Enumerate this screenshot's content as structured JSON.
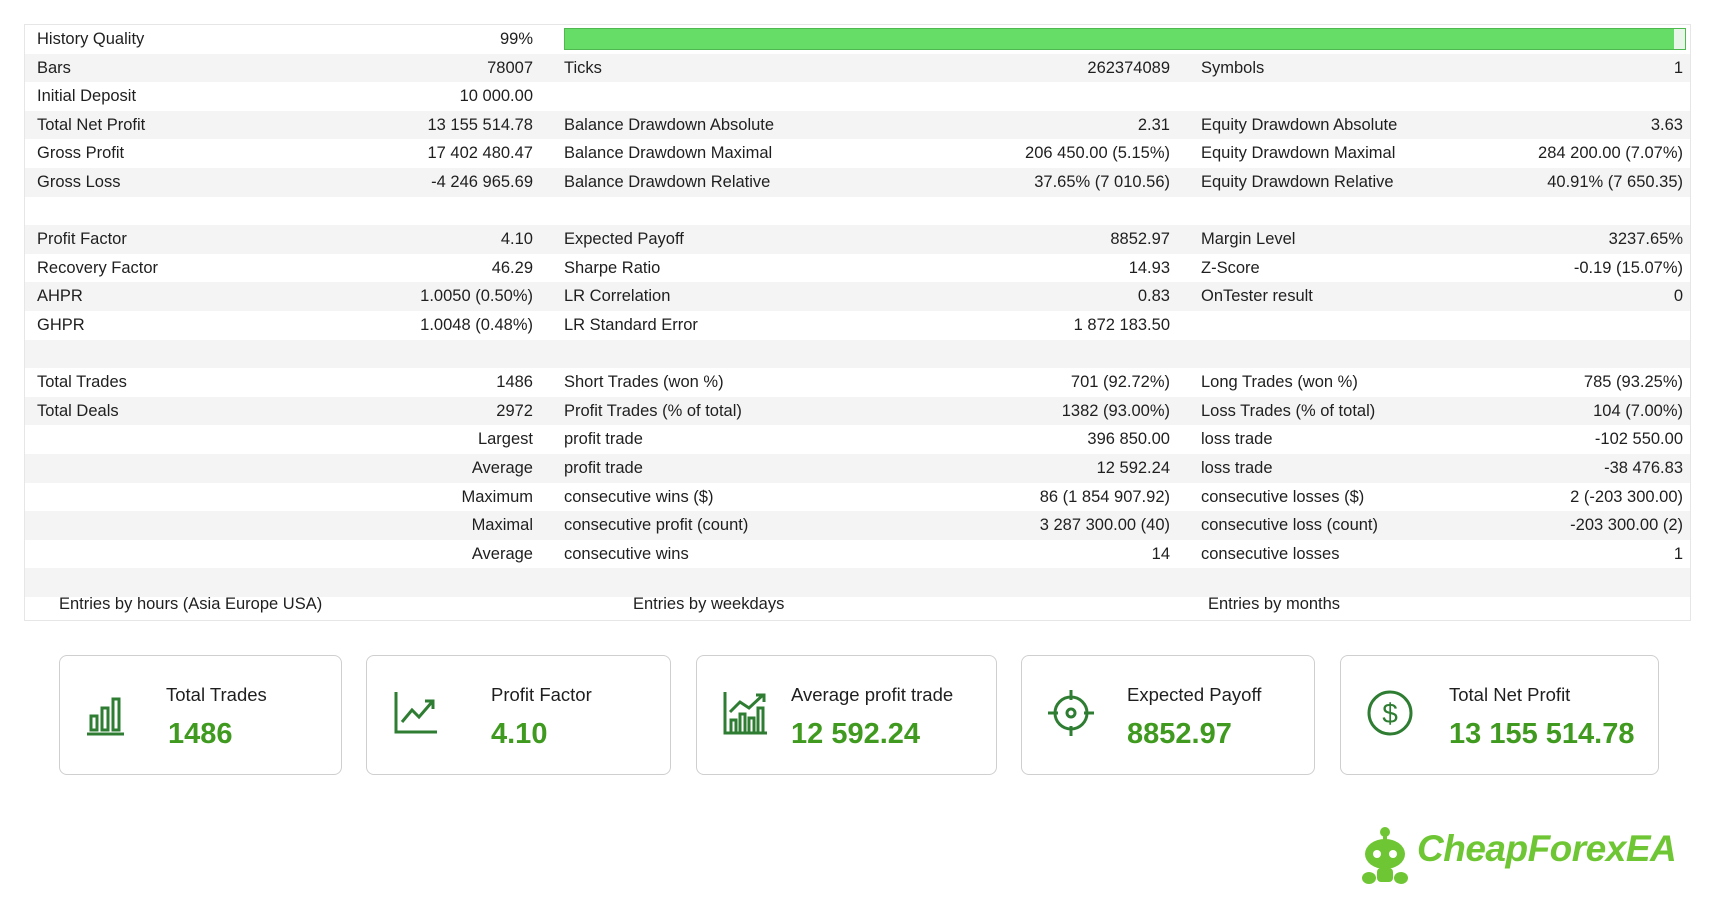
{
  "report": {
    "history_quality": {
      "label": "History Quality",
      "value": "99%",
      "fraction": 0.99
    },
    "rows": [
      {
        "l1": "Bars",
        "v1": "78007",
        "l2": "Ticks",
        "v2": "262374089",
        "l3": "Symbols",
        "v3": "1"
      },
      {
        "l1": "Initial Deposit",
        "v1": "10 000.00",
        "l2": "",
        "v2": "",
        "l3": "",
        "v3": ""
      },
      {
        "l1": "Total Net Profit",
        "v1": "13 155 514.78",
        "l2": "Balance Drawdown Absolute",
        "v2": "2.31",
        "l3": "Equity Drawdown Absolute",
        "v3": "3.63"
      },
      {
        "l1": "Gross Profit",
        "v1": "17 402 480.47",
        "l2": "Balance Drawdown Maximal",
        "v2": "206 450.00 (5.15%)",
        "l3": "Equity Drawdown Maximal",
        "v3": "284 200.00 (7.07%)"
      },
      {
        "l1": "Gross Loss",
        "v1": "-4 246 965.69",
        "l2": "Balance Drawdown Relative",
        "v2": "37.65% (7 010.56)",
        "l3": "Equity Drawdown Relative",
        "v3": "40.91% (7 650.35)"
      },
      {
        "l1": "",
        "v1": "",
        "l2": "",
        "v2": "",
        "l3": "",
        "v3": ""
      },
      {
        "l1": "Profit Factor",
        "v1": "4.10",
        "l2": "Expected Payoff",
        "v2": "8852.97",
        "l3": "Margin Level",
        "v3": "3237.65%"
      },
      {
        "l1": "Recovery Factor",
        "v1": "46.29",
        "l2": "Sharpe Ratio",
        "v2": "14.93",
        "l3": "Z-Score",
        "v3": "-0.19 (15.07%)"
      },
      {
        "l1": "AHPR",
        "v1": "1.0050 (0.50%)",
        "l2": "LR Correlation",
        "v2": "0.83",
        "l3": "OnTester result",
        "v3": "0"
      },
      {
        "l1": "GHPR",
        "v1": "1.0048 (0.48%)",
        "l2": "LR Standard Error",
        "v2": "1 872 183.50",
        "l3": "",
        "v3": ""
      },
      {
        "l1": "",
        "v1": "",
        "l2": "",
        "v2": "",
        "l3": "",
        "v3": ""
      },
      {
        "l1": "Total Trades",
        "v1": "1486",
        "l2": "Short Trades (won %)",
        "v2": "701 (92.72%)",
        "l3": "Long Trades (won %)",
        "v3": "785 (93.25%)"
      },
      {
        "l1": "Total Deals",
        "v1": "2972",
        "l2": "Profit Trades (% of total)",
        "v2": "1382 (93.00%)",
        "l3": "Loss Trades (% of total)",
        "v3": "104 (7.00%)"
      },
      {
        "l1": "",
        "v1": "Largest",
        "l2": "profit trade",
        "v2": "396 850.00",
        "l3": "loss trade",
        "v3": "-102 550.00"
      },
      {
        "l1": "",
        "v1": "Average",
        "l2": "profit trade",
        "v2": "12 592.24",
        "l3": "loss trade",
        "v3": "-38 476.83"
      },
      {
        "l1": "",
        "v1": "Maximum",
        "l2": "consecutive wins ($)",
        "v2": "86 (1 854 907.92)",
        "l3": "consecutive losses ($)",
        "v3": "2 (-203 300.00)"
      },
      {
        "l1": "",
        "v1": "Maximal",
        "l2": "consecutive profit (count)",
        "v2": "3 287 300.00 (40)",
        "l3": "consecutive loss (count)",
        "v3": "-203 300.00 (2)"
      },
      {
        "l1": "",
        "v1": "Average",
        "l2": "consecutive wins",
        "v2": "14",
        "l3": "consecutive losses",
        "v3": "1"
      },
      {
        "l1": "",
        "v1": "",
        "l2": "",
        "v2": "",
        "l3": "",
        "v3": ""
      }
    ],
    "entries": {
      "hours": "Entries by hours (Asia Europe USA)",
      "weekdays": "Entries by weekdays",
      "months": "Entries by months"
    }
  },
  "cards": [
    {
      "label": "Total Trades",
      "value": "1486",
      "icon": "bar-chart-icon"
    },
    {
      "label": "Profit Factor",
      "value": "4.10",
      "icon": "trend-up-icon"
    },
    {
      "label": "Average profit trade",
      "value": "12 592.24",
      "icon": "growth-chart-icon"
    },
    {
      "label": "Expected Payoff",
      "value": "8852.97",
      "icon": "target-icon"
    },
    {
      "label": "Total Net Profit",
      "value": "13 155 514.78",
      "icon": "dollar-coin-icon"
    }
  ],
  "brand": {
    "name": "CheapForexEA",
    "accent": "#6fc634",
    "value_color": "#3f9a1f",
    "bar_color": "#66dd66"
  }
}
